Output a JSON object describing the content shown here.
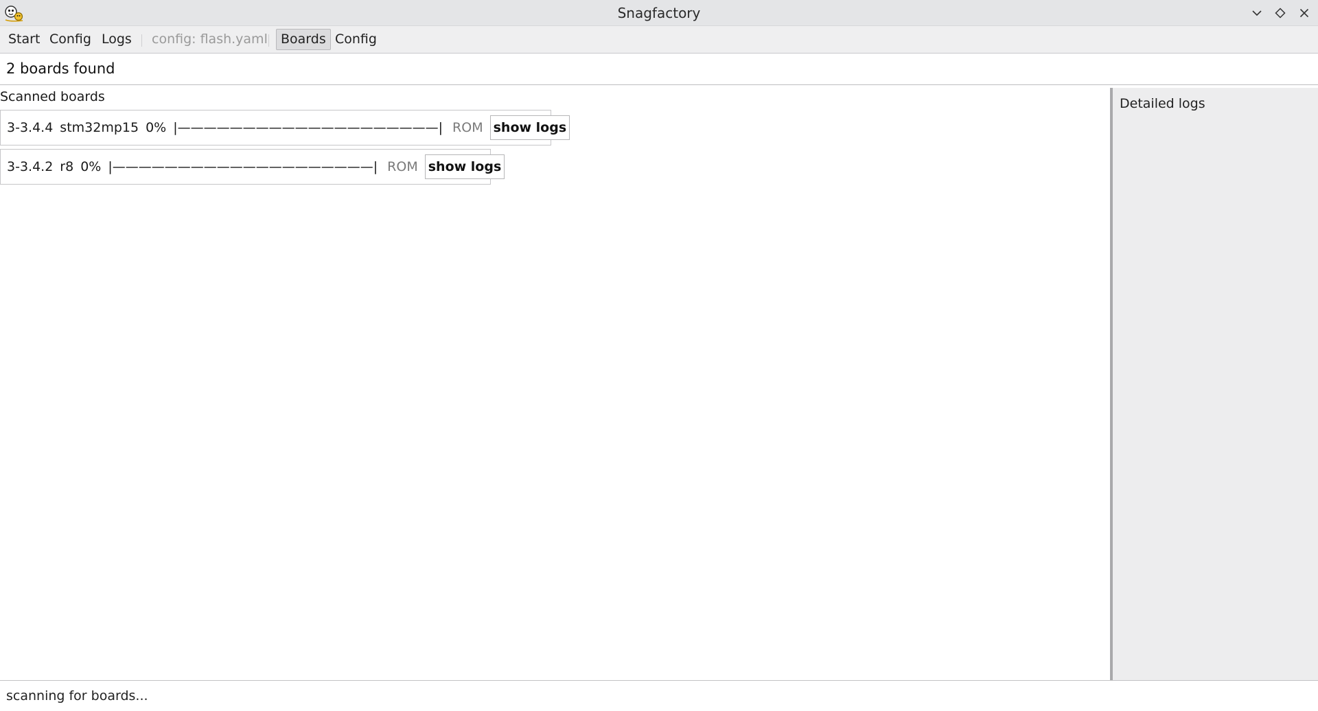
{
  "window": {
    "title": "Snagfactory"
  },
  "menubar": {
    "start": "Start",
    "config": "Config",
    "logs": "Logs",
    "config_file": "config: flash.yaml",
    "boards": "Boards",
    "config2": "Config"
  },
  "status_top": "2 boards found",
  "scanned_boards_label": "Scanned boards",
  "boards": [
    {
      "id": "3-3.4.4",
      "model": "stm32mp15",
      "progress_text": "0%",
      "progress": 0,
      "bar": "|————————————————————|",
      "phase": "ROM",
      "button": "show logs"
    },
    {
      "id": "3-3.4.2",
      "model": "r8",
      "progress_text": "0%",
      "progress": 0,
      "bar": "|————————————————————|",
      "phase": "ROM",
      "button": "show logs"
    }
  ],
  "detail_panel": {
    "title": "Detailed logs"
  },
  "status_bottom": "scanning for boards...",
  "icons": {
    "app": "snagfactory-logo-icon",
    "minimize": "chevron-down-icon",
    "maximize": "diamond-icon",
    "close": "close-icon"
  },
  "colors": {
    "titlebar_bg": "#e4e5e7",
    "menubar_bg": "#efeff0",
    "panel_bg": "#ededee",
    "disabled_text": "#9a9a9a"
  }
}
